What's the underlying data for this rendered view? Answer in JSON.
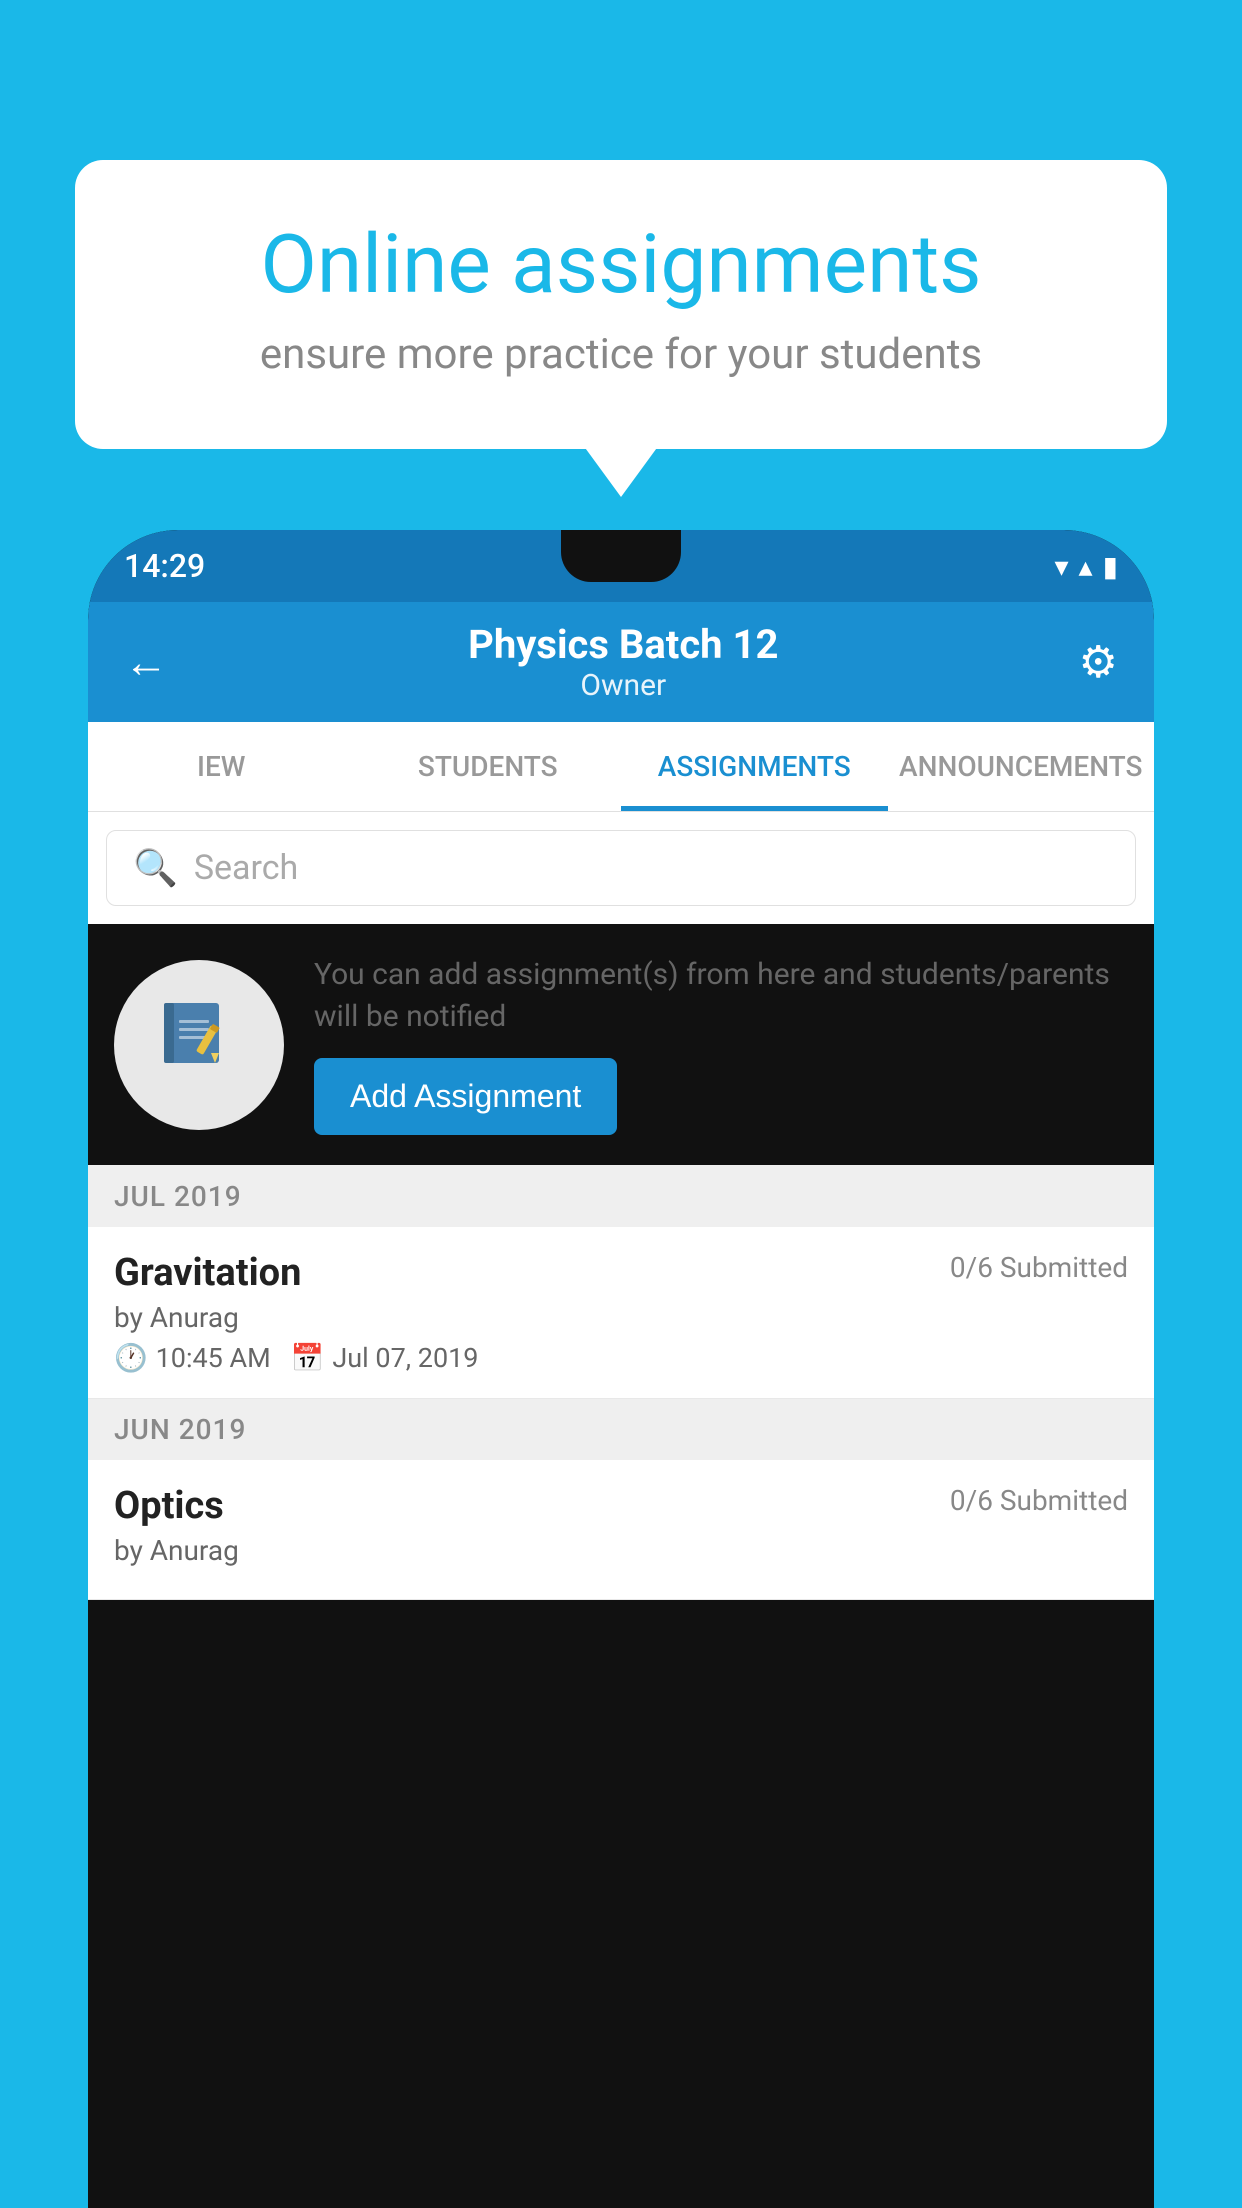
{
  "background": {
    "color": "#1ab8e8"
  },
  "speech_bubble": {
    "title": "Online assignments",
    "subtitle": "ensure more practice for your students"
  },
  "status_bar": {
    "time": "14:29",
    "wifi_icon": "▼",
    "signal_icon": "▲",
    "battery_icon": "▮"
  },
  "app_header": {
    "back_icon": "←",
    "title": "Physics Batch 12",
    "subtitle": "Owner",
    "settings_icon": "⚙"
  },
  "tabs": [
    {
      "label": "IEW",
      "active": false
    },
    {
      "label": "STUDENTS",
      "active": false
    },
    {
      "label": "ASSIGNMENTS",
      "active": true
    },
    {
      "label": "ANNOUNCEMENTS",
      "active": false
    }
  ],
  "search": {
    "placeholder": "Search",
    "search_icon": "🔍"
  },
  "promo_section": {
    "icon": "📓",
    "description": "You can add assignment(s) from here and students/parents will be notified",
    "button_label": "Add Assignment"
  },
  "assignment_groups": [
    {
      "month_label": "JUL 2019",
      "assignments": [
        {
          "name": "Gravitation",
          "submitted": "0/6 Submitted",
          "author": "by Anurag",
          "time": "10:45 AM",
          "date": "Jul 07, 2019"
        }
      ]
    },
    {
      "month_label": "JUN 2019",
      "assignments": [
        {
          "name": "Optics",
          "submitted": "0/6 Submitted",
          "author": "by Anurag",
          "time": "",
          "date": ""
        }
      ]
    }
  ]
}
